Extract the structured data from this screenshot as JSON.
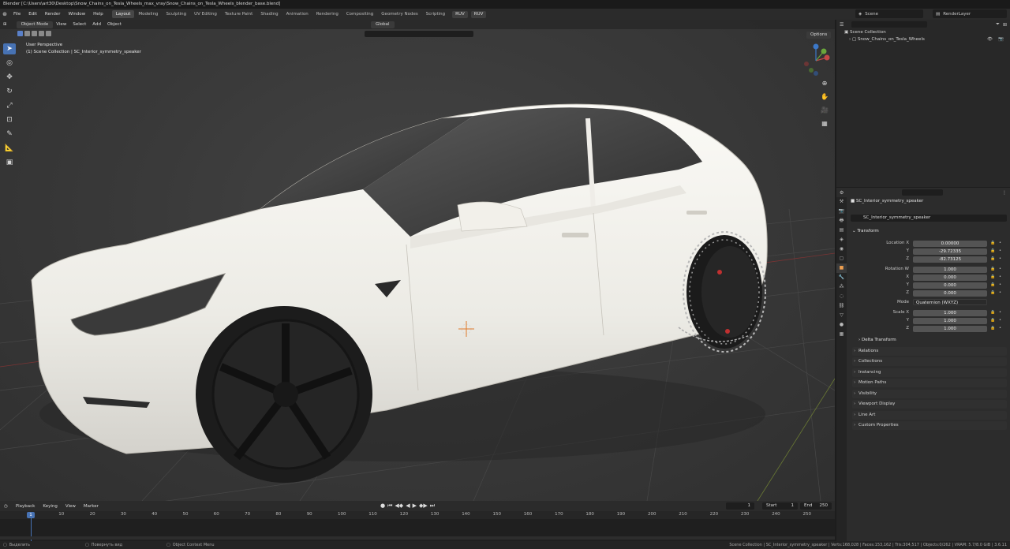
{
  "window": {
    "title": "Blender [C:\\Users\\art30\\Desktop\\Snow_Chains_on_Tesla_Wheels_max_vray\\Snow_Chains_on_Tesla_Wheels_blender_base.blend]"
  },
  "menu": [
    "File",
    "Edit",
    "Render",
    "Window",
    "Help"
  ],
  "workspaces": [
    {
      "label": "Layout",
      "active": true
    },
    {
      "label": "Modeling"
    },
    {
      "label": "Sculpting"
    },
    {
      "label": "UV Editing"
    },
    {
      "label": "Texture Paint"
    },
    {
      "label": "Shading"
    },
    {
      "label": "Animation"
    },
    {
      "label": "Rendering"
    },
    {
      "label": "Compositing"
    },
    {
      "label": "Geometry Nodes"
    },
    {
      "label": "Scripting"
    }
  ],
  "ruv_buttons": [
    "RUV",
    "RUV"
  ],
  "scene": {
    "name": "Scene",
    "render_layer": "RenderLayer"
  },
  "viewport": {
    "mode": "Object Mode",
    "header_menu": [
      "View",
      "Select",
      "Add",
      "Object"
    ],
    "orientation": "Global",
    "options_label": "Options",
    "info_line1": "User Perspective",
    "info_line2": "(1) Scene Collection | SC_Interior_symmetry_speaker"
  },
  "outliner": {
    "root": "Scene Collection",
    "children": [
      "Snow_Chains_on_Tesla_Wheels"
    ]
  },
  "properties": {
    "object_name": "SC_Interior_symmetry_speaker",
    "data_name": "SC_Interior_symmetry_speaker",
    "transform_title": "Transform",
    "location": {
      "label_x": "Location X",
      "label_y": "Y",
      "label_z": "Z",
      "x": "0.00000",
      "y": "-29.72335",
      "z": "-82.73125"
    },
    "rotation": {
      "label_w": "Rotation W",
      "label_x": "X",
      "label_y": "Y",
      "label_z": "Z",
      "w": "1.000",
      "x": "0.000",
      "y": "0.000",
      "z": "0.000"
    },
    "mode": {
      "label": "Mode",
      "value": "Quaternion (WXYZ)"
    },
    "scale": {
      "label_x": "Scale X",
      "label_y": "Y",
      "label_z": "Z",
      "x": "1.000",
      "y": "1.000",
      "z": "1.000"
    },
    "delta_transform": "Delta Transform",
    "sections": [
      "Relations",
      "Collections",
      "Instancing",
      "Motion Paths",
      "Visibility",
      "Viewport Display",
      "Line Art",
      "Custom Properties"
    ]
  },
  "timeline": {
    "menu": [
      "Playback",
      "Keying",
      "View",
      "Marker"
    ],
    "current_frame": "1",
    "start_label": "Start",
    "start": "1",
    "end_label": "End",
    "end": "250",
    "ruler_ticks": [
      "10",
      "20",
      "30",
      "40",
      "50",
      "60",
      "70",
      "80",
      "90",
      "100",
      "110",
      "120",
      "130",
      "140",
      "150",
      "160",
      "170",
      "180",
      "190",
      "200",
      "210",
      "220",
      "230",
      "240",
      "250"
    ]
  },
  "statusbar": {
    "select": "Выделить",
    "rotate": "Повернуть вид",
    "context": "Object Context Menu",
    "stats": "Scene Collection | SC_Interior_symmetry_speaker | Verts:168,028 | Faces:153,162 | Tris:304,517 | Objects:0/262 | VRAM: 5.7/8.0 GiB | 3.6.11"
  },
  "colors": {
    "accent": "#4772b3",
    "car_body": "#f1eee8",
    "tire": "#1e1e1e",
    "grid": "#474747"
  }
}
